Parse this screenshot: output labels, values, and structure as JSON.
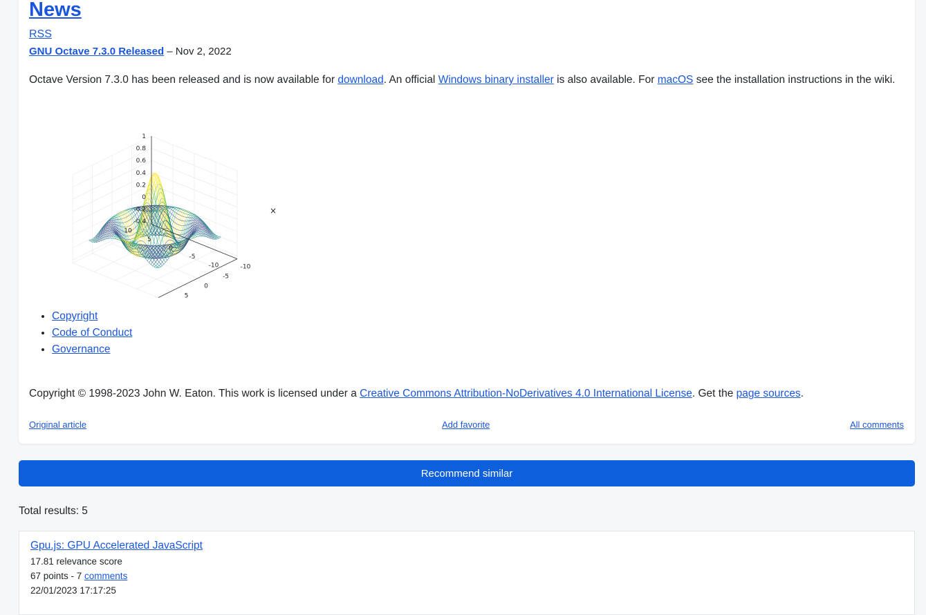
{
  "article": {
    "heading": "News",
    "rss_label": "RSS",
    "release_link": "GNU Octave 7.3.0 Released",
    "release_date": " – Nov 2, 2022",
    "para_part1": "Octave Version 7.3.0 has been released and is now available for ",
    "download_link": "download",
    "para_part2": ". An official ",
    "windows_link": "Windows binary installer",
    "para_part3": " is also available. For ",
    "macos_link": "macOS",
    "para_part4": " see the installation instructions in the wiki.",
    "plot": {
      "z_ticks": [
        "1",
        "0.8",
        "0.6",
        "0.4",
        "0.2",
        "0",
        "-0.2",
        "-0.4"
      ],
      "y_ticks": [
        "10",
        "5",
        "0",
        "-5",
        "-10"
      ],
      "x_ticks": [
        "-10",
        "-5",
        "0",
        "5",
        "10"
      ],
      "close_glyph": "×",
      "colormap": [
        "#440154",
        "#3b528b",
        "#21918c",
        "#5ec962",
        "#fde725"
      ]
    },
    "footer_links": [
      "Copyright",
      "Code of Conduct",
      "Governance"
    ],
    "copyright_part1": "Copyright © 1998-2023 John W. Eaton. This work is licensed under a ",
    "license_link": "Creative Commons Attribution-NoDerivatives 4.0 International License",
    "copyright_part2": ". Get the ",
    "sources_link": "page sources",
    "copyright_part3": "."
  },
  "actions": {
    "original_article": "Original article",
    "add_favorite": "Add favorite",
    "all_comments": "All comments"
  },
  "recommend_button": "Recommend similar",
  "total_results": "Total results: 5",
  "results": [
    {
      "title": "Gpu.js: GPU Accelerated JavaScript",
      "score": "17.81 relevance score",
      "points_prefix": "67 points - 7 ",
      "comments_link": "comments",
      "date": "22/01/2023 17:17:25"
    }
  ],
  "colors": {
    "link": "#1a56db",
    "button": "#0d5fdc",
    "background": "#f6f7f9"
  }
}
